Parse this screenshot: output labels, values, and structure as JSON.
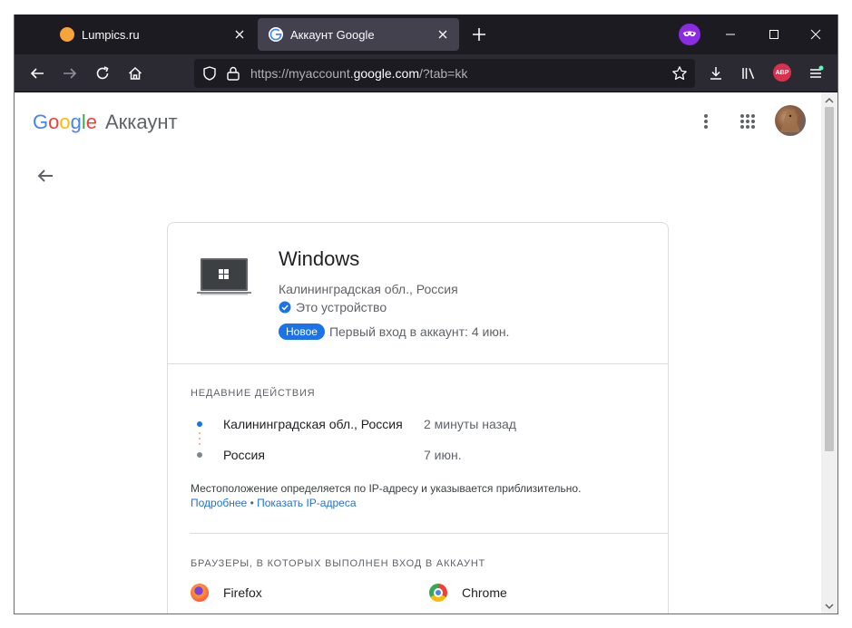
{
  "browser": {
    "tabs": [
      {
        "title": "Lumpics.ru",
        "active": false
      },
      {
        "title": "Аккаунт Google",
        "active": true
      }
    ],
    "url_prefix": "https://myaccount.",
    "url_domain": "google.com",
    "url_suffix": "/?tab=kk",
    "abp_label": "ABP",
    "colors": {
      "tabbar": "#1c1b22",
      "navbar": "#2b2a33",
      "active_tab": "#42414d"
    }
  },
  "header": {
    "logo_letters": [
      "G",
      "o",
      "o",
      "g",
      "l",
      "e"
    ],
    "logo_colors": [
      "#4285f4",
      "#ea4335",
      "#fbbc05",
      "#4285f4",
      "#34a853",
      "#ea4335"
    ],
    "product": "Аккаунт"
  },
  "device": {
    "name": "Windows",
    "location": "Калининградская обл., Россия",
    "this_device": "Это устройство",
    "new_badge": "Новое",
    "first_login": "Первый вход в аккаунт: 4 июн."
  },
  "recent": {
    "title": "НЕДАВНИЕ ДЕЙСТВИЯ",
    "items": [
      {
        "place": "Калининградская обл., Россия",
        "time": "2 минуты назад"
      },
      {
        "place": "Россия",
        "time": "7 июн."
      }
    ],
    "note": "Местоположение определяется по IP-адресу и указывается приблизительно.",
    "link_more": "Подробнее",
    "separator": " • ",
    "link_ip": "Показать IP-адреса"
  },
  "browsers": {
    "title": "БРАУЗЕРЫ, В КОТОРЫХ ВЫПОЛНЕН ВХОД В АККАУНТ",
    "items": [
      {
        "name": "Firefox",
        "icon": "firefox-icon"
      },
      {
        "name": "Chrome",
        "icon": "chrome-icon"
      }
    ]
  },
  "accent_color": "#1a73e8"
}
